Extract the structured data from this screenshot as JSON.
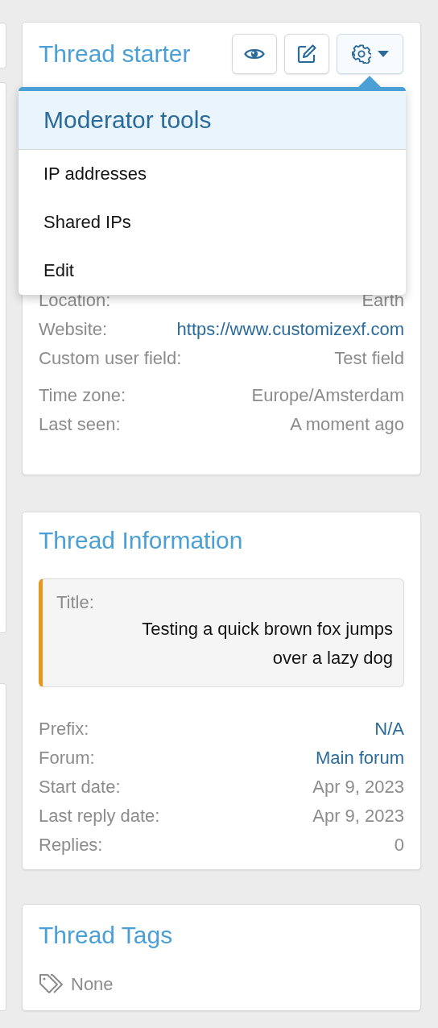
{
  "thread_starter": {
    "title": "Thread starter",
    "moderator_menu": {
      "open": true,
      "heading": "Moderator tools",
      "items": [
        {
          "label": "IP addresses"
        },
        {
          "label": "Shared IPs"
        },
        {
          "label": "Edit"
        }
      ]
    },
    "field_groups": [
      [
        {
          "label": "Location:",
          "value": "Earth",
          "link": false
        },
        {
          "label": "Website:",
          "value": "https://www.customizexf.com",
          "link": true
        },
        {
          "label": "Custom user field:",
          "value": "Test field",
          "link": false
        }
      ],
      [
        {
          "label": "Time zone:",
          "value": "Europe/Amsterdam",
          "link": false
        },
        {
          "label": "Last seen:",
          "value": "A moment ago",
          "link": false
        }
      ]
    ]
  },
  "thread_information": {
    "title": "Thread Information",
    "title_label": "Title:",
    "thread_title": "Testing a quick brown fox jumps over a lazy dog",
    "fields": [
      {
        "label": "Prefix:",
        "value": "N/A",
        "link": true
      },
      {
        "label": "Forum:",
        "value": "Main forum",
        "link": true
      },
      {
        "label": "Start date:",
        "value": "Apr 9, 2023",
        "link": false
      },
      {
        "label": "Last reply date:",
        "value": "Apr 9, 2023",
        "link": false
      },
      {
        "label": "Replies:",
        "value": "0",
        "link": false
      }
    ]
  },
  "thread_tags": {
    "title": "Thread Tags",
    "value": "None"
  }
}
